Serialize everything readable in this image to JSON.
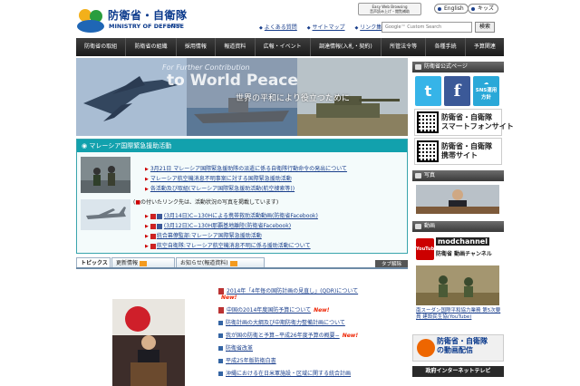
{
  "header": {
    "logo_jp": "防衛省・自衛隊",
    "logo_en": "MINISTRY OF DEFENSE",
    "logo_top": "▸TOP",
    "easyweb_line1": "Easy Web Browsing",
    "easyweb_line2": "音声読み上げ・閲覧補助",
    "english_label": "English",
    "kids_label": "キッズ",
    "links": [
      "よくある質問",
      "サイトマップ",
      "リンク集"
    ],
    "search_placeholder": "Google™ Custom Search",
    "search_button": "検索"
  },
  "nav": {
    "items": [
      "防衛省の取組",
      "防衛省の組織",
      "採用情報",
      "報道資料",
      "広報・イベント",
      "調達情報(入札・契約)",
      "所管法令等",
      "各種手続",
      "予算関連"
    ]
  },
  "banner": {
    "tagline": "For Further Contribution",
    "big": "to World Peace",
    "jp": "世界の平和により役立つために"
  },
  "news": {
    "title": "マレーシア国際緊急援助活動",
    "links": [
      "3月21日 マレーシア国際緊急援助隊の派遣に係る自衛隊行動命令の発出について",
      "マレーシア航空機消息不明事案に対する国際緊急援助活動",
      "各活動及び取組(マレーシア国際緊急援助活動(航空捜索等))"
    ],
    "note_prefix": "(",
    "note_mark": "■",
    "note_suffix": "の付いたリンク先は、活動状況の写真を掲載しています)",
    "social_links": [
      "(3月14日)C−130Hによる携帯救助活動動画(防衛省Facebook)",
      "(3月12日)C−130H那覇基地離陸(防衛省Facebook)",
      "統合幕僚監部:マレーシア国際緊急援助活動",
      "航空自衛隊:マレーシア航空機消息不明に係る援助活動について"
    ]
  },
  "tabs": {
    "topics": "トピックス",
    "updates": "更新情報",
    "notices": "お知らせ(報道資料)",
    "list": "タブ解除"
  },
  "topics": [
    {
      "label": "2014年「4年毎の国防計画の見直し」(QDR)について",
      "new": "New!"
    },
    {
      "label": "中国の2014年度国防予算について",
      "new": "New!"
    },
    {
      "label": "防衛計画の大綱及び中期防衛力整備計画について",
      "new": ""
    },
    {
      "label": "我が国の防衛と予算−平成26年度予算の概要−",
      "new": "New!"
    },
    {
      "label": "防衛省改革",
      "new": ""
    },
    {
      "label": "平成25年版防衛白書",
      "new": ""
    },
    {
      "label": "沖縄における在日米軍施設・区域に関する統合計画",
      "new": ""
    }
  ],
  "sidebar": {
    "official_head": "防衛省公式ページ",
    "sns_label": "SNS運用方針",
    "qr1_line1": "防衛省・自衛隊",
    "qr1_line2": "スマートフォンサイト",
    "qr2_line1": "防衛省・自衛隊",
    "qr2_line2": "携帯サイト",
    "photo_head": "写真",
    "video_head": "動画",
    "yt_logo": "YouTube",
    "yt_title": "modchannel",
    "yt_sub": "防衛省 動画チャンネル",
    "video_caption": "南スーダン国際平和協力業務 第5次要員 建設民生協(YouTube)",
    "mod_video_line1": "防衛省・自衛隊",
    "mod_video_line2": "の動画配信",
    "gov_tv": "政府インターネットテレビ"
  },
  "colors": {
    "news_header": "#12a1ad",
    "nav_bg": "#2a2a2a",
    "link": "#1a3f8c",
    "new_badge": "#ee2200"
  }
}
